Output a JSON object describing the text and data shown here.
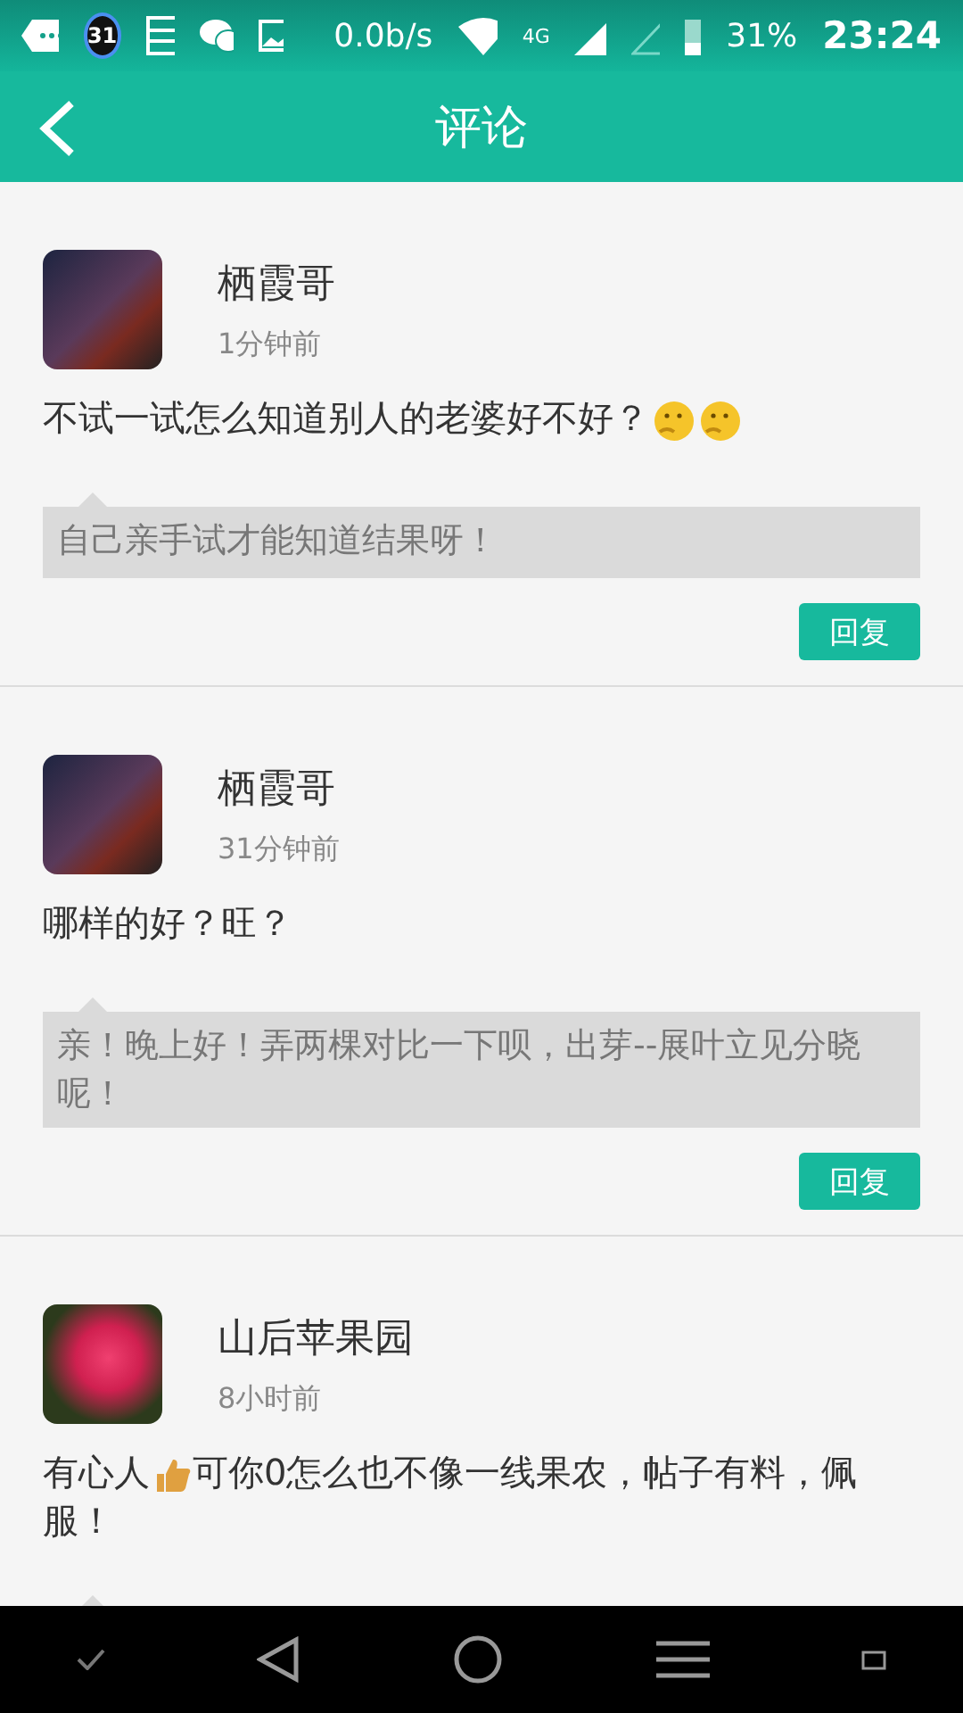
{
  "status_bar": {
    "calendar_badge": "31",
    "speed": "0.0b/s",
    "network": "4G",
    "battery": "31%",
    "time": "23:24"
  },
  "header": {
    "title": "评论"
  },
  "comments": [
    {
      "name": "栖霞哥",
      "time": "1分钟前",
      "avatar": {
        "kind": "game"
      },
      "content": [
        {
          "kind": "text",
          "text": "不试一试怎么知道别人的老婆好不好？"
        },
        {
          "kind": "face"
        },
        {
          "kind": "face"
        }
      ],
      "reply": "自己亲手试才能知道结果呀！",
      "reply_button": "回复"
    },
    {
      "name": "栖霞哥",
      "time": "31分钟前",
      "avatar": {
        "kind": "game"
      },
      "content": [
        {
          "kind": "text",
          "text": "哪样的好？旺？"
        }
      ],
      "reply": "亲！晚上好！弄两棵对比一下呗，出芽--展叶立见分晓呢！",
      "reply_button": "回复"
    },
    {
      "name": "山后苹果园",
      "time": "8小时前",
      "avatar": {
        "kind": "flower"
      },
      "content": [
        {
          "kind": "text",
          "text": "有心人"
        },
        {
          "kind": "thumb"
        },
        {
          "kind": "text",
          "text": "可你0怎么也不像一线果农，帖子有料，佩服！"
        }
      ]
    }
  ]
}
